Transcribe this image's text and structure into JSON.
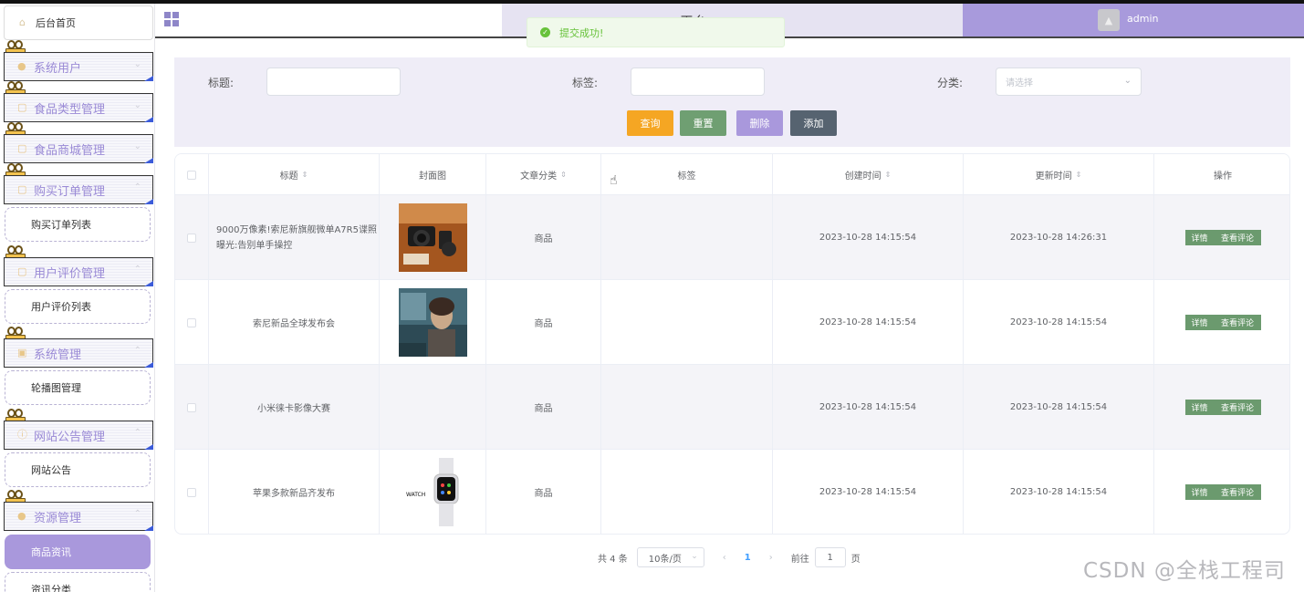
{
  "header": {
    "title": "…平台",
    "user": "admin"
  },
  "toast": "提交成功!",
  "sidebar": {
    "home": "后台首页",
    "groups": [
      {
        "label": "系统用户"
      },
      {
        "label": "食品类型管理"
      },
      {
        "label": "食品商城管理"
      },
      {
        "label": "购买订单管理",
        "sub": "购买订单列表"
      },
      {
        "label": "用户评价管理",
        "sub": "用户评价列表"
      },
      {
        "label": "系统管理",
        "sub": "轮播图管理"
      },
      {
        "label": "网站公告管理",
        "sub": "网站公告"
      },
      {
        "label": "资源管理",
        "sub": "商品资讯",
        "sub2": "资讯分类"
      }
    ]
  },
  "search": {
    "title_label": "标题:",
    "tag_label": "标签:",
    "category_label": "分类:",
    "category_placeholder": "请选择",
    "buttons": {
      "query": "查询",
      "reset": "重置",
      "delete": "删除",
      "add": "添加"
    },
    "colors": {
      "query": "#f5a623",
      "reset": "#6f9f72",
      "delete": "#a998dc",
      "add": "#566370"
    }
  },
  "table": {
    "columns": [
      "标题",
      "封面图",
      "文章分类",
      "标签",
      "创建时间",
      "更新时间",
      "操作"
    ],
    "rows": [
      {
        "title": "9000万像素!索尼新旗舰微单A7R5谍照曝光:告别单手操控",
        "category": "商品",
        "tag": "",
        "created": "2023-10-28 14:15:54",
        "updated": "2023-10-28 14:26:31"
      },
      {
        "title": "索尼新品全球发布会",
        "category": "商品",
        "tag": "",
        "created": "2023-10-28 14:15:54",
        "updated": "2023-10-28 14:15:54"
      },
      {
        "title": "小米徕卡影像大赛",
        "category": "商品",
        "tag": "",
        "created": "2023-10-28 14:15:54",
        "updated": "2023-10-28 14:15:54"
      },
      {
        "title": "苹果多款新品齐发布",
        "category": "商品",
        "tag": "",
        "created": "2023-10-28 14:15:54",
        "updated": "2023-10-28 14:15:54"
      }
    ],
    "op_detail": "详情",
    "op_comments": "查看评论",
    "watch_text": "WATCH"
  },
  "pager": {
    "total": "共 4 条",
    "size": "10条/页",
    "prev": "‹",
    "current": "1",
    "next": "›",
    "goto": "前往",
    "goto_value": "1",
    "page_unit": "页"
  },
  "watermark": "CSDN @全栈工程司"
}
